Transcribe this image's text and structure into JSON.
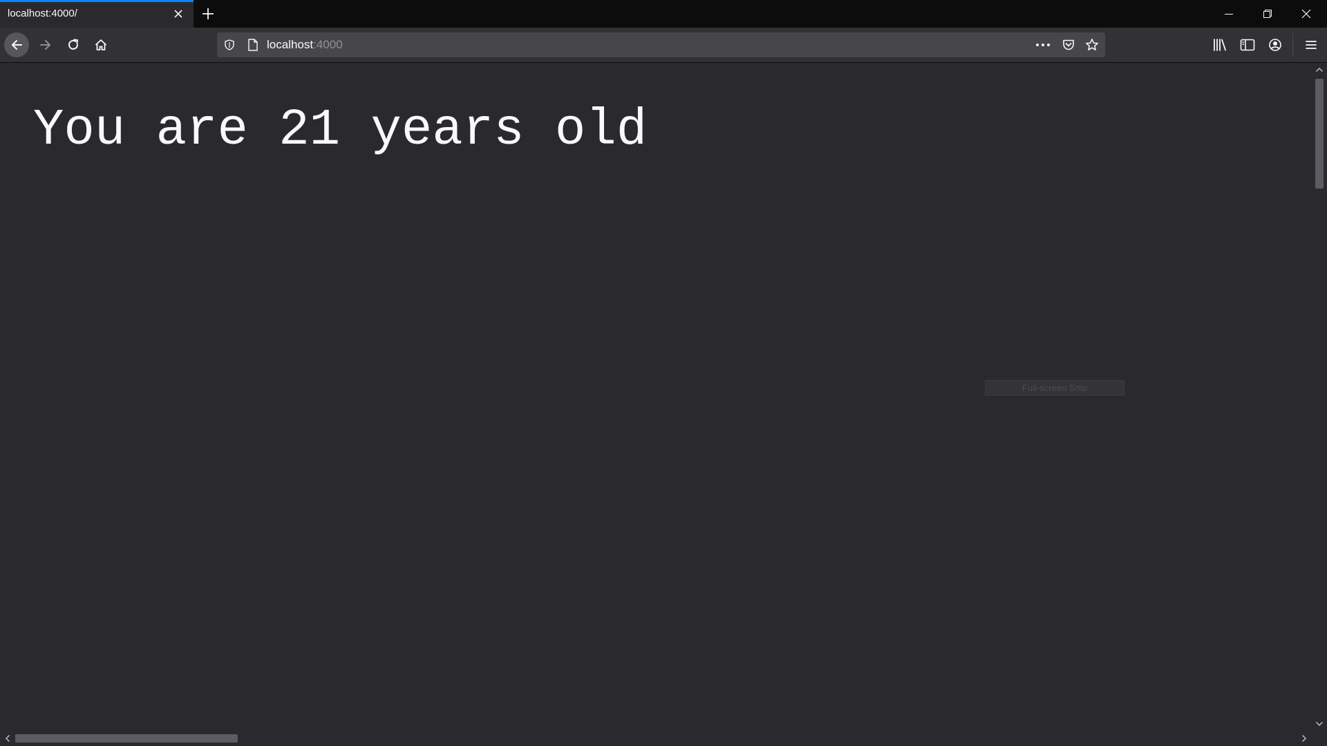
{
  "browser": {
    "tab": {
      "title": "localhost:4000/",
      "active": true
    },
    "url": {
      "host": "localhost",
      "port": ":4000"
    },
    "icons": {
      "tab_close": "close-icon",
      "new_tab": "plus-icon",
      "minimize": "minimize-icon",
      "restore": "restore-icon",
      "close_window": "close-icon",
      "back": "arrow-left-icon",
      "forward": "arrow-right-icon",
      "reload": "reload-icon",
      "home": "home-icon",
      "tracking_protection": "shield-icon",
      "page_info": "page-icon",
      "page_actions": "more-icon",
      "pocket": "pocket-icon",
      "bookmark": "star-icon",
      "library": "library-icon",
      "sidebar": "sidebar-icon",
      "account": "account-icon",
      "menu": "hamburger-menu-icon"
    },
    "colors": {
      "accent": "#0a84ff",
      "toolbar": "#323234",
      "tabstrip": "#0c0c0d",
      "urlbar": "#474749",
      "page_background": "#2a2a2e",
      "text": "#f9f9fa"
    }
  },
  "page": {
    "heading": "You are 21 years old"
  },
  "overlay": {
    "snip_label": "Full-screen Snip"
  }
}
